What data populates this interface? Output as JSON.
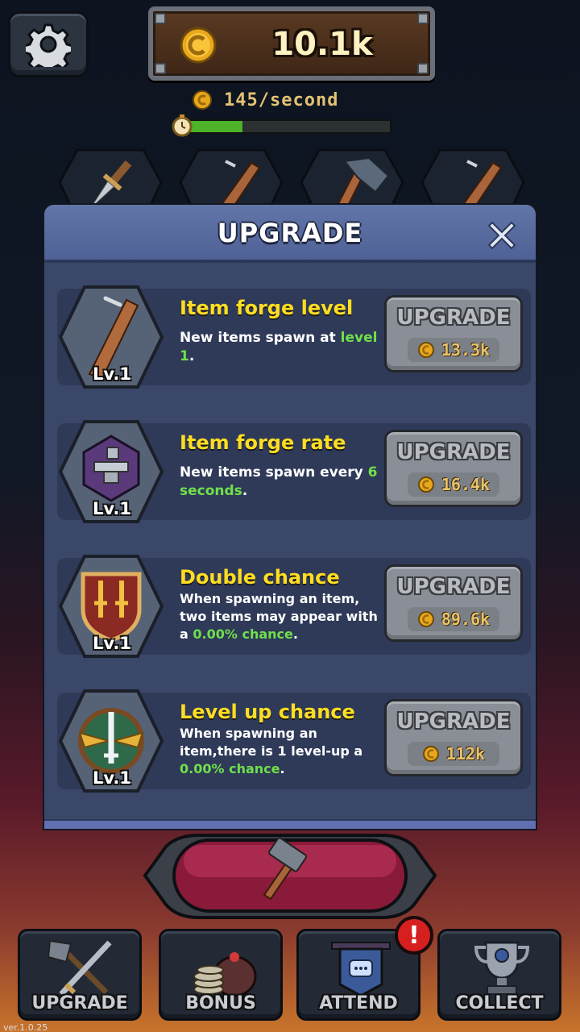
{
  "header": {
    "gold": "10.1k",
    "rate": "145/second",
    "timer_progress": 0.28
  },
  "panel": {
    "title": "UPGRADE",
    "rows": [
      {
        "title": "Item forge level",
        "desc_plain": "New items spawn at",
        "desc_highlight": "level 1",
        "desc_tail": ".",
        "level": "Lv.1",
        "button": "UPGRADE",
        "price": "13.3k"
      },
      {
        "title": "Item forge rate",
        "desc_plain": "New items spawn every",
        "desc_highlight": "6 seconds",
        "desc_tail": ".",
        "level": "Lv.1",
        "button": "UPGRADE",
        "price": "16.4k"
      },
      {
        "title": "Double chance",
        "desc_plain": "When spawning an item, two items may appear with a",
        "desc_highlight": "0.00% chance",
        "desc_tail": ".",
        "level": "Lv.1",
        "button": "UPGRADE",
        "price": "89.6k"
      },
      {
        "title": "Level up chance",
        "desc_plain": "When spawning an item,there is 1 level-up a",
        "desc_highlight": "0.00% chance",
        "desc_tail": ".",
        "level": "Lv.1",
        "button": "UPGRADE",
        "price": "112k"
      }
    ]
  },
  "nav": {
    "upgrade": "UPGRADE",
    "bonus": "BONUS",
    "attend": "ATTEND",
    "collect": "COLLECT",
    "alert": "!"
  },
  "version": "ver.1.0.25",
  "icons": {
    "settings": "gear-icon",
    "coin": "coin-icon",
    "timer": "stopwatch-icon",
    "close": "close-icon",
    "forge": "hammer-icon"
  },
  "colors": {
    "title_yellow": "#ffdd22",
    "highlight_green": "#6fe04a",
    "panel_bg": "#3a4769",
    "alert_red": "#d62020"
  }
}
